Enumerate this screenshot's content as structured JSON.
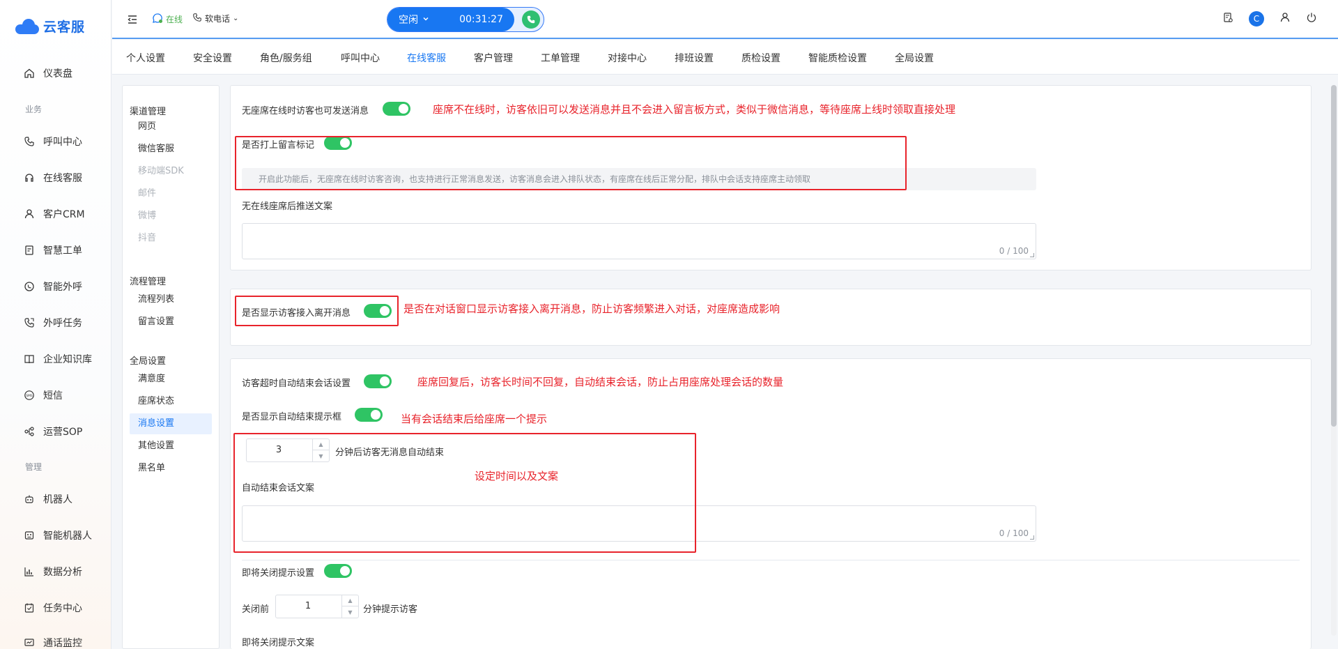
{
  "app": {
    "logo_text": "云客服"
  },
  "sidebar": {
    "items": [
      {
        "label": "仪表盘",
        "icon": "home-icon"
      },
      {
        "group": "业务"
      },
      {
        "label": "呼叫中心",
        "icon": "phone-icon"
      },
      {
        "label": "在线客服",
        "icon": "headset-icon"
      },
      {
        "label": "客户CRM",
        "icon": "user-icon"
      },
      {
        "label": "智慧工单",
        "icon": "ticket-icon"
      },
      {
        "label": "智能外呼",
        "icon": "whatsapp-phone-icon"
      },
      {
        "label": "外呼任务",
        "icon": "call-task-icon"
      },
      {
        "label": "企业知识库",
        "icon": "book-icon"
      },
      {
        "label": "短信",
        "icon": "sms-icon"
      },
      {
        "label": "运营SOP",
        "icon": "sop-icon"
      },
      {
        "group": "管理"
      },
      {
        "label": "机器人",
        "icon": "robot-icon"
      },
      {
        "label": "智能机器人",
        "icon": "smart-robot-icon"
      },
      {
        "label": "数据分析",
        "icon": "chart-icon"
      },
      {
        "label": "任务中心",
        "icon": "task-icon"
      },
      {
        "label": "通话监控",
        "icon": "monitor-icon"
      }
    ]
  },
  "topbar": {
    "status": "在线",
    "phone_mode": "软电话",
    "call_state": "空闲",
    "call_timer": "00:31:27",
    "avatar_letter": "C"
  },
  "tabs": [
    {
      "label": "个人设置"
    },
    {
      "label": "安全设置"
    },
    {
      "label": "角色/服务组"
    },
    {
      "label": "呼叫中心"
    },
    {
      "label": "在线客服",
      "active": true
    },
    {
      "label": "客户管理"
    },
    {
      "label": "工单管理"
    },
    {
      "label": "对接中心"
    },
    {
      "label": "排班设置"
    },
    {
      "label": "质检设置"
    },
    {
      "label": "智能质检设置"
    },
    {
      "label": "全局设置"
    }
  ],
  "sub_sidebar": {
    "groups": [
      {
        "title": "渠道管理",
        "items": [
          {
            "label": "网页"
          },
          {
            "label": "微信客服"
          },
          {
            "label": "移动端SDK",
            "disabled": true
          },
          {
            "label": "邮件",
            "disabled": true
          },
          {
            "label": "微博",
            "disabled": true
          },
          {
            "label": "抖音",
            "disabled": true
          }
        ]
      },
      {
        "title": "流程管理",
        "items": [
          {
            "label": "流程列表"
          },
          {
            "label": "留言设置"
          }
        ]
      },
      {
        "title": "全局设置",
        "items": [
          {
            "label": "满意度"
          },
          {
            "label": "座席状态"
          },
          {
            "label": "消息设置",
            "active": true
          },
          {
            "label": "其他设置"
          },
          {
            "label": "黑名单"
          }
        ]
      }
    ]
  },
  "panel1": {
    "offline_send_label": "无座席在线时访客也可发送消息",
    "offline_send_annot": "座席不在线时，访客依旧可以发送消息并且不会进入留言板方式，类似于微信消息，等待座席上线时领取直接处理",
    "mark_label": "是否打上留言标记",
    "hint": "开启此功能后，无座席在线时访客咨询，也支持进行正常消息发送，访客消息会进入排队状态，有座席在线后正常分配，排队中会话支持座席主动领取",
    "push_text_label": "无在线座席后推送文案",
    "push_text_count": "0 / 100"
  },
  "panel2": {
    "show_join_leave_label": "是否显示访客接入离开消息",
    "show_join_leave_annot": "是否在对话窗口显示访客接入离开消息，防止访客频繁进入对话，对座席造成影响"
  },
  "panel3": {
    "auto_end_label": "访客超时自动结束会话设置",
    "auto_end_annot": "座席回复后，访客长时间不回复，自动结束会话，防止占用座席处理会话的数量",
    "show_end_tip_label": "是否显示自动结束提示框",
    "show_end_tip_annot": "当有会话结束后给座席一个提示",
    "minutes_value": "3",
    "minutes_suffix": "分钟后访客无消息自动结束",
    "time_text_annot": "设定时间以及文案",
    "auto_end_text_label": "自动结束会话文案",
    "auto_end_text_count": "0 / 100",
    "closing_tip_label": "即将关闭提示设置",
    "before_close_label": "关闭前",
    "before_close_value": "1",
    "before_close_suffix": "分钟提示访客",
    "closing_tip_text_label": "即将关闭提示文案"
  }
}
